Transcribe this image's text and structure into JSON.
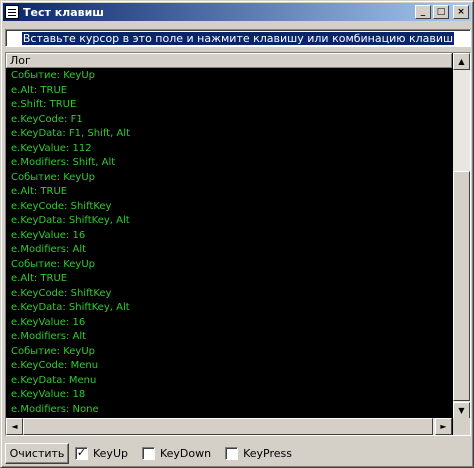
{
  "window": {
    "title": "Тест клавиш",
    "minimize_glyph": "_",
    "maximize_glyph": "□",
    "close_glyph": "×"
  },
  "hint": {
    "text": "Вставьте курсор в это поле и нажмите клавишу или комбинацию клавиш"
  },
  "log": {
    "header": "Лог",
    "lines": [
      "Событие: KeyUp",
      "e.Alt: TRUE",
      "e.Shift: TRUE",
      "e.KeyCode: F1",
      "e.KeyData: F1, Shift, Alt",
      "e.KeyValue: 112",
      "e.Modifiers: Shift, Alt",
      "Событие: KeyUp",
      "e.Alt: TRUE",
      "e.KeyCode: ShiftKey",
      "e.KeyData: ShiftKey, Alt",
      "e.KeyValue: 16",
      "e.Modifiers: Alt",
      "Событие: KeyUp",
      "e.Alt: TRUE",
      "e.KeyCode: ShiftKey",
      "e.KeyData: ShiftKey, Alt",
      "e.KeyValue: 16",
      "e.Modifiers: Alt",
      "Событие: KeyUp",
      "e.KeyCode: Menu",
      "e.KeyData: Menu",
      "e.KeyValue: 18",
      "e.Modifiers: None"
    ],
    "text_color": "#2ecc2e",
    "background": "#000000"
  },
  "scroll": {
    "up_glyph": "▲",
    "down_glyph": "▼",
    "left_glyph": "◄",
    "right_glyph": "►"
  },
  "bottom": {
    "clear_label": "Очистить",
    "checkboxes": [
      {
        "label": "KeyUp",
        "checked": true,
        "mark": "✓"
      },
      {
        "label": "KeyDown",
        "checked": false,
        "mark": ""
      },
      {
        "label": "KeyPress",
        "checked": false,
        "mark": ""
      }
    ]
  },
  "colors": {
    "face": "#d4d0c8",
    "titlebar_start": "#0a246a",
    "titlebar_end": "#a6caf0",
    "selection": "#0a246a"
  }
}
